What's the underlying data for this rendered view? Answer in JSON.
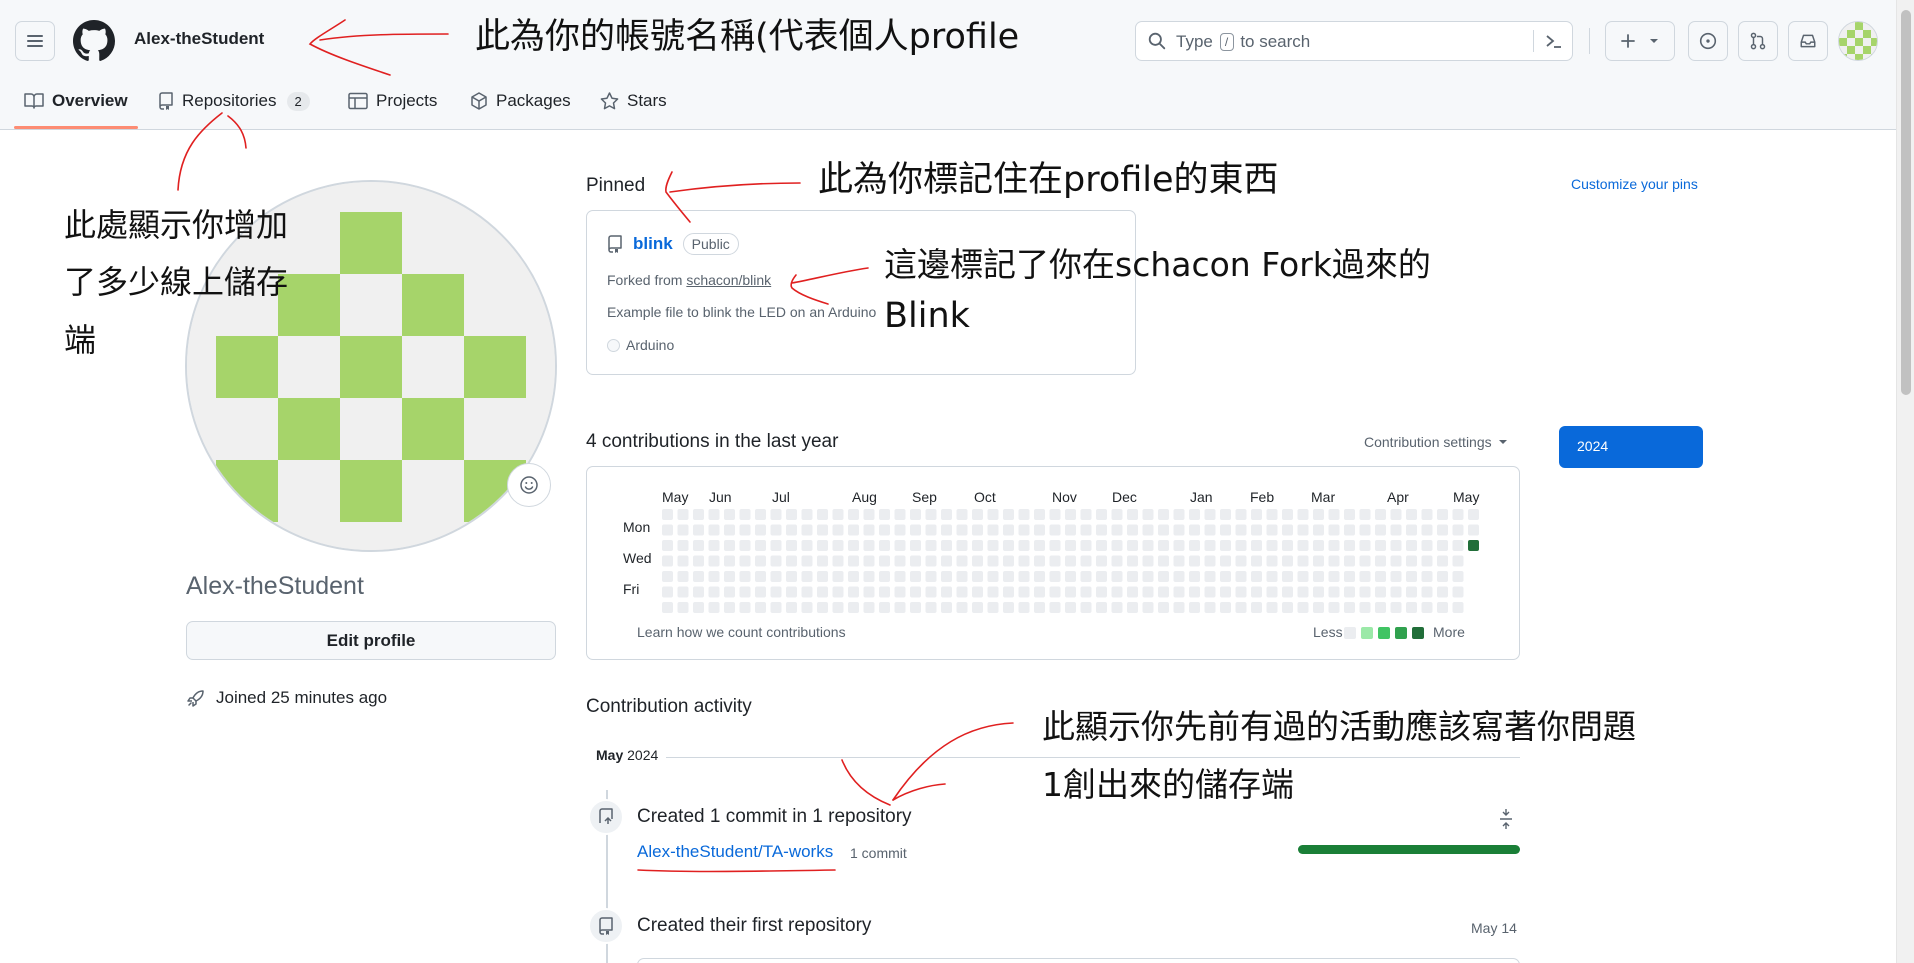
{
  "header": {
    "username": "Alex-theStudent",
    "search_text": "Type / to search",
    "search_prefix": "Type",
    "search_key": "/",
    "search_suffix": "to search"
  },
  "tabs": [
    {
      "label": "Overview",
      "icon": "book-icon",
      "selected": true
    },
    {
      "label": "Repositories",
      "icon": "repo-icon",
      "count": "2"
    },
    {
      "label": "Projects",
      "icon": "table-icon"
    },
    {
      "label": "Packages",
      "icon": "package-icon"
    },
    {
      "label": "Stars",
      "icon": "star-icon"
    }
  ],
  "profile": {
    "name": "Alex-theStudent",
    "edit_label": "Edit profile",
    "joined": "Joined 25 minutes ago"
  },
  "pinned": {
    "title": "Pinned",
    "customize": "Customize your pins",
    "repo": {
      "name": "blink",
      "visibility": "Public",
      "forked_prefix": "Forked from",
      "forked_from": "schacon/blink",
      "description": "Example file to blink the LED on an Arduino",
      "language": "Arduino"
    }
  },
  "contributions": {
    "title": "4 contributions in the last year",
    "settings": "Contribution settings",
    "year": "2024",
    "months": [
      "May",
      "Jun",
      "Jul",
      "Aug",
      "Sep",
      "Oct",
      "Nov",
      "Dec",
      "Jan",
      "Feb",
      "Mar",
      "Apr",
      "May"
    ],
    "days": [
      "Mon",
      "Wed",
      "Fri"
    ],
    "learn": "Learn how we count contributions",
    "less": "Less",
    "more": "More",
    "active_cell": {
      "week": 52,
      "day": "Tue",
      "level": 4
    }
  },
  "activity": {
    "title": "Contribution activity",
    "month_label_bold": "May",
    "month_label_year": "2024",
    "items": [
      {
        "text": "Created 1 commit in 1 repository",
        "link": "Alex-theStudent/TA-works",
        "detail": "1 commit"
      },
      {
        "text": "Created their first repository",
        "date": "May 14"
      }
    ]
  },
  "annotations": {
    "username": "此為你的帳號名稱(代表個人profile",
    "repos": [
      "此處顯示你增加",
      "了多少線上儲存",
      "端"
    ],
    "pinned": "此為你標記住在profile的東西",
    "fork": [
      "這邊標記了你在schacon Fork過來的",
      "Blink"
    ],
    "activity": [
      "此顯示你先前有過的活動應該寫著你問題",
      "1創出來的儲存端"
    ]
  },
  "colors": {
    "accent": "#0969da",
    "tab_underline": "#fd8c73",
    "contrib_levels": [
      "#ebedf0",
      "#9be9a8",
      "#40c463",
      "#30a14e",
      "#216e39"
    ],
    "identicon": "#a6d46a",
    "annotation_ink": "#e02020"
  }
}
